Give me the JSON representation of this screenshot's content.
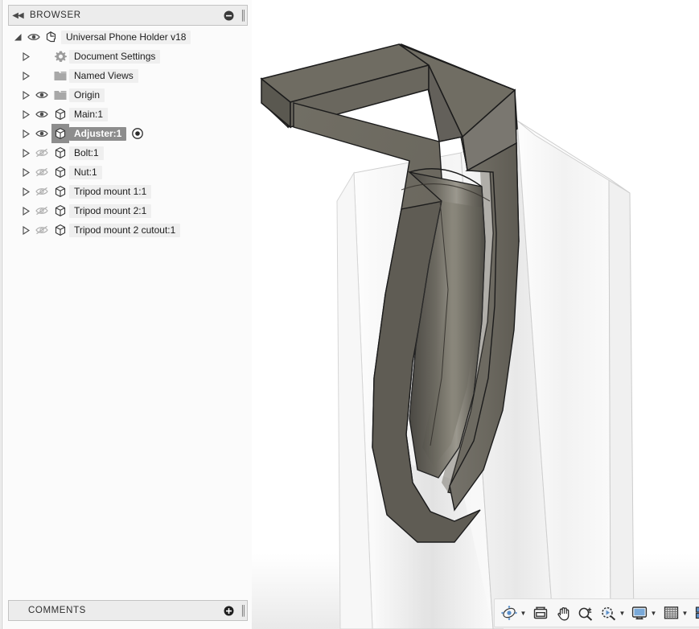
{
  "app": {
    "product": "CAD 3D modeling application",
    "accent_color": "#5b8fc9",
    "selection_color": "#8d8d8d",
    "model_color": "#6a675e"
  },
  "browser_panel": {
    "title": "BROWSER",
    "collapse_icon": "double-left-chevron-icon",
    "minimize_icon": "minus-circle-icon",
    "grip_icon": "panel-grip-icon",
    "tree": [
      {
        "id": "root",
        "label": "Universal Phone Holder v18",
        "level": 0,
        "expander": "expanded-triangle-icon",
        "visibility_icon": "eye-visible-icon",
        "visible": true,
        "node_icon": "assembly-document-icon",
        "selected": false,
        "has_eye": true
      },
      {
        "id": "document-settings",
        "label": "Document Settings",
        "level": 1,
        "expander": "collapsed-triangle-icon",
        "visibility_icon": "",
        "visible": null,
        "node_icon": "gear-icon",
        "selected": false,
        "has_eye": false
      },
      {
        "id": "named-views",
        "label": "Named Views",
        "level": 1,
        "expander": "collapsed-triangle-icon",
        "visibility_icon": "",
        "visible": null,
        "node_icon": "folder-icon",
        "selected": false,
        "has_eye": false
      },
      {
        "id": "origin",
        "label": "Origin",
        "level": 1,
        "expander": "collapsed-triangle-icon",
        "visibility_icon": "eye-visible-icon",
        "visible": true,
        "node_icon": "folder-icon",
        "selected": false,
        "has_eye": true
      },
      {
        "id": "main-1",
        "label": "Main:1",
        "level": 1,
        "expander": "collapsed-triangle-icon",
        "visibility_icon": "eye-visible-icon",
        "visible": true,
        "node_icon": "component-icon",
        "selected": false,
        "has_eye": true
      },
      {
        "id": "adjuster-1",
        "label": "Adjuster:1",
        "level": 1,
        "expander": "collapsed-triangle-icon",
        "visibility_icon": "eye-visible-icon",
        "visible": true,
        "node_icon": "component-icon",
        "selected": true,
        "has_eye": true,
        "active_icon": "activated-component-radio-icon"
      },
      {
        "id": "bolt-1",
        "label": "Bolt:1",
        "level": 1,
        "expander": "collapsed-triangle-icon",
        "visibility_icon": "eye-hidden-icon",
        "visible": false,
        "node_icon": "component-icon",
        "selected": false,
        "has_eye": true
      },
      {
        "id": "nut-1",
        "label": "Nut:1",
        "level": 1,
        "expander": "collapsed-triangle-icon",
        "visibility_icon": "eye-hidden-icon",
        "visible": false,
        "node_icon": "component-icon",
        "selected": false,
        "has_eye": true
      },
      {
        "id": "tripod-mount-1-1",
        "label": "Tripod mount 1:1",
        "level": 1,
        "expander": "collapsed-triangle-icon",
        "visibility_icon": "eye-hidden-icon",
        "visible": false,
        "node_icon": "component-icon",
        "selected": false,
        "has_eye": true
      },
      {
        "id": "tripod-mount-2-1",
        "label": "Tripod mount 2:1",
        "level": 1,
        "expander": "collapsed-triangle-icon",
        "visibility_icon": "eye-hidden-icon",
        "visible": false,
        "node_icon": "component-icon",
        "selected": false,
        "has_eye": true
      },
      {
        "id": "tripod-mount-2-cutout-1",
        "label": "Tripod mount 2 cutout:1",
        "level": 1,
        "expander": "collapsed-triangle-icon",
        "visibility_icon": "eye-hidden-icon",
        "visible": false,
        "node_icon": "component-icon",
        "selected": false,
        "has_eye": true
      }
    ]
  },
  "comments_panel": {
    "title": "COMMENTS",
    "add_icon": "plus-circle-icon",
    "grip_icon": "panel-grip-icon"
  },
  "navigation_bar": {
    "items": [
      {
        "id": "orbit",
        "icon": "orbit-icon",
        "has_dropdown": true
      },
      {
        "id": "look-at",
        "icon": "look-at-icon",
        "has_dropdown": false
      },
      {
        "id": "pan",
        "icon": "pan-hand-icon",
        "has_dropdown": false
      },
      {
        "id": "zoom",
        "icon": "zoom-plus-minus-icon",
        "has_dropdown": false
      },
      {
        "id": "fit",
        "icon": "zoom-window-icon",
        "has_dropdown": true
      },
      {
        "id": "display-settings",
        "icon": "monitor-display-icon",
        "has_dropdown": true
      },
      {
        "id": "grid-snaps",
        "icon": "grid-icon",
        "has_dropdown": true
      },
      {
        "id": "viewports",
        "icon": "viewports-icon",
        "has_dropdown": true
      }
    ]
  },
  "viewport": {
    "model_name": "Adjuster",
    "shaded_body_color": "#6a675e",
    "ghost_body_color": "#f7f7f7",
    "edge_color": "#1d1d1d",
    "background": "#ffffff"
  }
}
